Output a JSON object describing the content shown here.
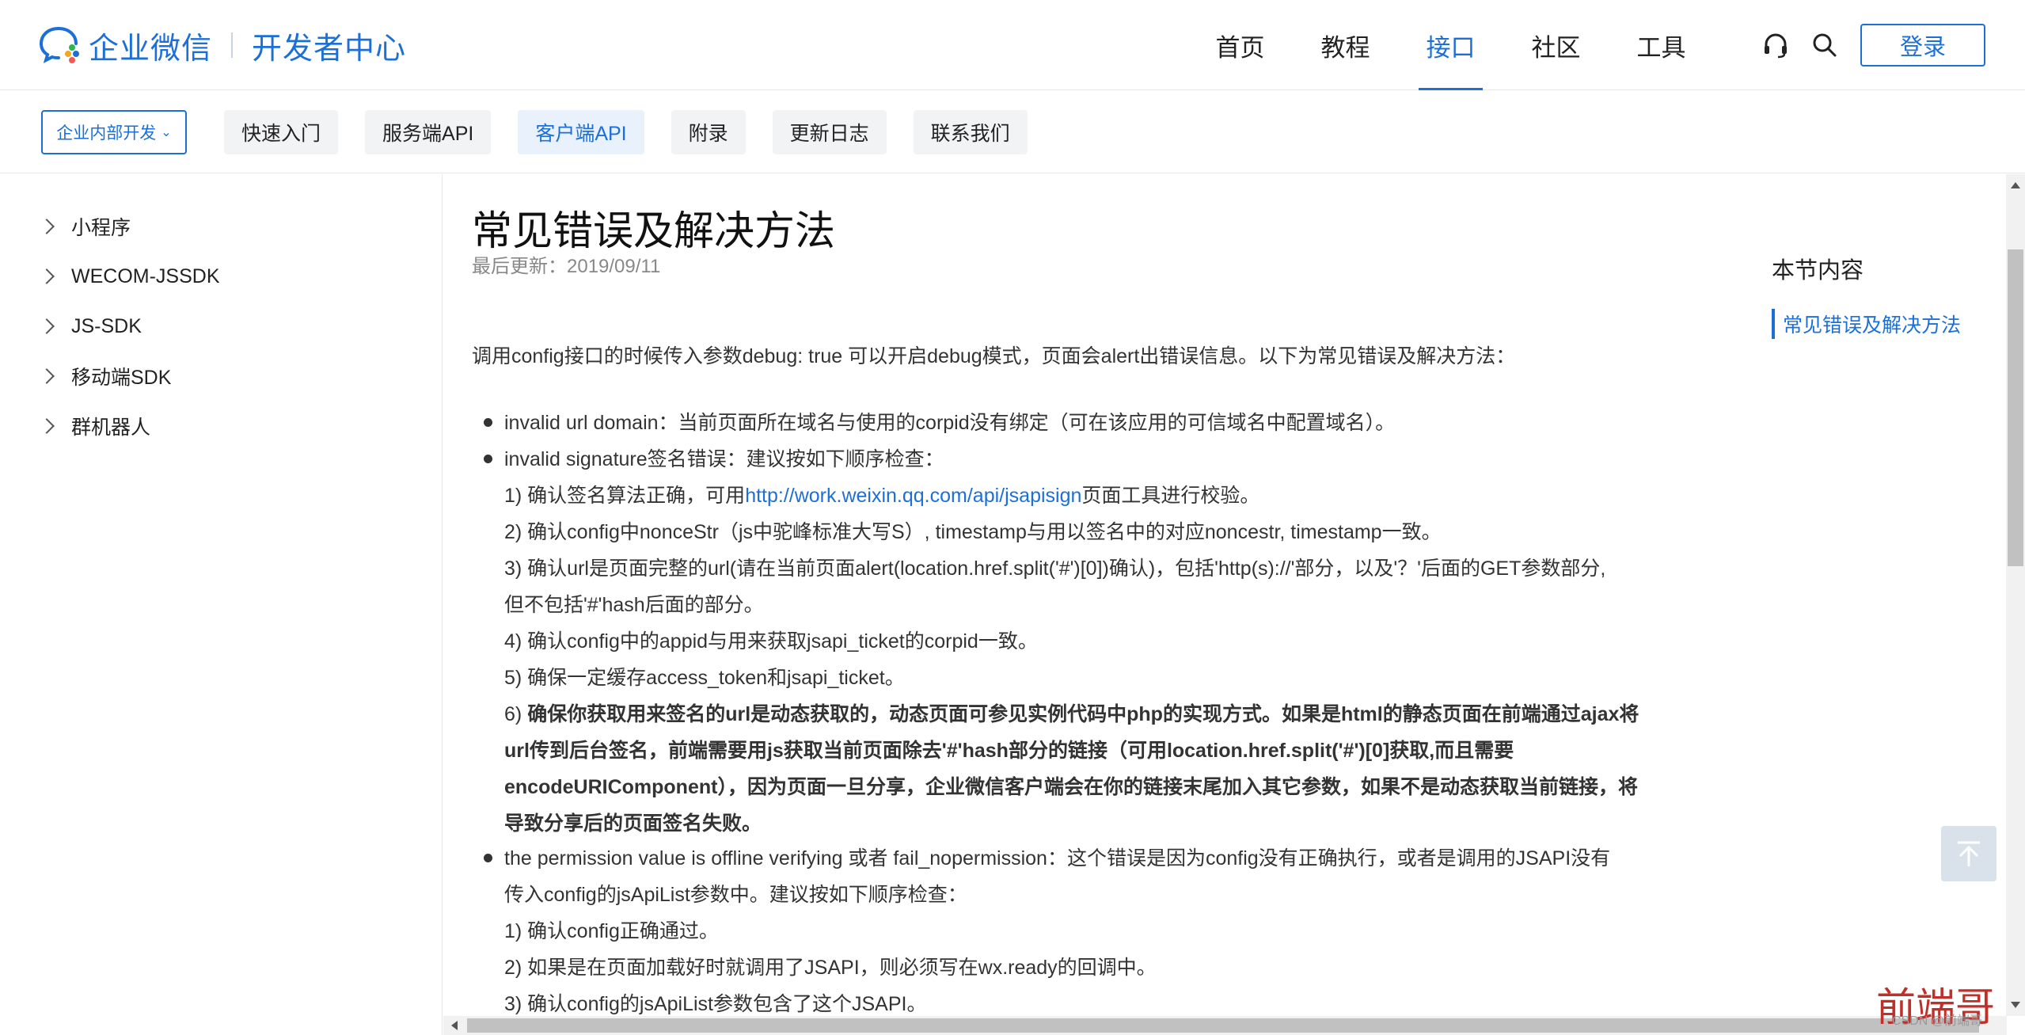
{
  "header": {
    "logo_name": "企业微信",
    "logo_sub": "开发者中心",
    "nav": [
      {
        "label": "首页",
        "active": false
      },
      {
        "label": "教程",
        "active": false
      },
      {
        "label": "接口",
        "active": true
      },
      {
        "label": "社区",
        "active": false
      },
      {
        "label": "工具",
        "active": false
      }
    ],
    "support_icon": "headset-icon",
    "search_icon": "search-icon",
    "login_label": "登录"
  },
  "subnav": {
    "dropdown_label": "企业内部开发",
    "tabs": [
      {
        "label": "快速入门",
        "active": false
      },
      {
        "label": "服务端API",
        "active": false
      },
      {
        "label": "客户端API",
        "active": true
      },
      {
        "label": "附录",
        "active": false
      },
      {
        "label": "更新日志",
        "active": false
      },
      {
        "label": "联系我们",
        "active": false
      }
    ]
  },
  "sidebar": {
    "items": [
      {
        "label": "小程序"
      },
      {
        "label": "WECOM-JSSDK"
      },
      {
        "label": "JS-SDK"
      },
      {
        "label": "移动端SDK"
      },
      {
        "label": "群机器人"
      }
    ]
  },
  "article": {
    "title": "常见错误及解决方法",
    "updated": "最后更新：2019/09/11",
    "intro": "调用config接口的时候传入参数debug: true 可以开启debug模式，页面会alert出错误信息。以下为常见错误及解决方法：",
    "b1": "invalid url domain：当前页面所在域名与使用的corpid没有绑定（可在该应用的可信域名中配置域名）。",
    "b2": "invalid signature签名错误：建议按如下顺序检查：",
    "b2_1_pre": "1) 确认签名算法正确，可用",
    "b2_1_link": "http://work.weixin.qq.com/api/jsapisign",
    "b2_1_post": "页面工具进行校验。",
    "b2_2": "2) 确认config中nonceStr（js中驼峰标准大写S）, timestamp与用以签名中的对应noncestr, timestamp一致。",
    "b2_3a": "3) 确认url是页面完整的url(请在当前页面alert(location.href.split('#')[0])确认)，包括'http(s)://'部分，以及'？'后面的GET参数部分,",
    "b2_3b": "但不包括'#'hash后面的部分。",
    "b2_4": "4) 确认config中的appid与用来获取jsapi_ticket的corpid一致。",
    "b2_5": "5) 确保一定缓存access_token和jsapi_ticket。",
    "b2_6_pre": "6) ",
    "b2_6a": "确保你获取用来签名的url是动态获取的，动态页面可参见实例代码中php的实现方式。如果是html的静态页面在前端通过ajax将",
    "b2_6b": "url传到后台签名，前端需要用js获取当前页面除去'#'hash部分的链接（可用location.href.split('#')[0]获取,而且需要",
    "b2_6c": "encodeURIComponent），因为页面一旦分享，企业微信客户端会在你的链接末尾加入其它参数，如果不是动态获取当前链接，将",
    "b2_6d": "导致分享后的页面签名失败。",
    "b3a": "the permission value is offline verifying 或者 fail_nopermission：这个错误是因为config没有正确执行，或者是调用的JSAPI没有",
    "b3b": "传入config的jsApiList参数中。建议按如下顺序检查：",
    "b3_1": "1) 确认config正确通过。",
    "b3_2": "2) 如果是在页面加载好时就调用了JSAPI，则必须写在wx.ready的回调中。",
    "b3_3": "3) 确认config的jsApiList参数包含了这个JSAPI。"
  },
  "toc": {
    "title": "本节内容",
    "item": "常见错误及解决方法"
  },
  "backtop_icon": "arrow-up-icon",
  "watermark": {
    "text": "前端哥",
    "small": "CSDN @前端哥"
  },
  "colors": {
    "accent": "#1d6fd8",
    "text": "#333333"
  }
}
